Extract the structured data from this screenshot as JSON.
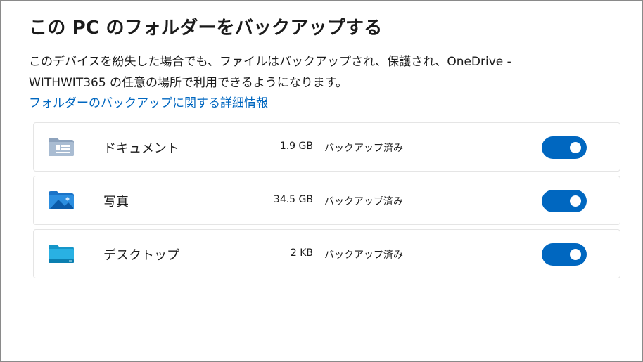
{
  "dialog": {
    "title": "この PC のフォルダーをバックアップする",
    "description_lines": [
      "このデバイスを紛失した場合でも、ファイルはバックアップされ、保護され、OneDrive -",
      "WITHWIT365 の任意の場所で利用できるようになります。"
    ],
    "learn_more_link": "フォルダーのバックアップに関する詳細情報"
  },
  "folders": [
    {
      "name": "ドキュメント",
      "size": "1.9 GB",
      "status": "バックアップ済み",
      "icon": "documents-folder-icon",
      "backup_enabled": true
    },
    {
      "name": "写真",
      "size": "34.5 GB",
      "status": "バックアップ済み",
      "icon": "pictures-folder-icon",
      "backup_enabled": true
    },
    {
      "name": "デスクトップ",
      "size": "2 KB",
      "status": "バックアップ済み",
      "icon": "desktop-folder-icon",
      "backup_enabled": true
    }
  ],
  "colors": {
    "accent": "#0067c0",
    "link": "#0067c0",
    "row_border": "#e5e5e5"
  }
}
